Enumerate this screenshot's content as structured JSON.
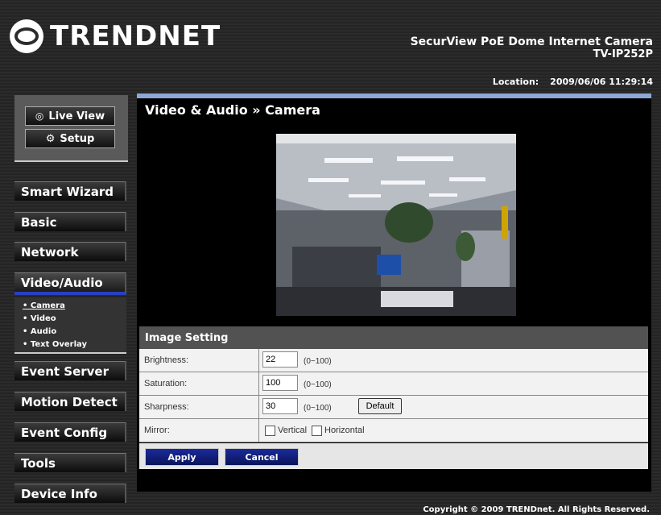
{
  "header": {
    "brand": "TRENDNET",
    "product_name": "SecurView PoE Dome Internet Camera",
    "model": "TV-IP252P",
    "location_label": "Location:",
    "datetime": "2009/06/06 11:29:14"
  },
  "quick_buttons": {
    "live_view": "Live View",
    "setup": "Setup"
  },
  "menu": {
    "smart_wizard": "Smart Wizard",
    "basic": "Basic",
    "network": "Network",
    "video_audio": "Video/Audio",
    "event_server": "Event Server",
    "motion_detect": "Motion Detect",
    "event_config": "Event Config",
    "tools": "Tools",
    "device_info": "Device Info"
  },
  "submenu": {
    "camera": "• Camera",
    "video": "• Video",
    "audio": "• Audio",
    "text_overlay": "• Text Overlay"
  },
  "page_title": "Video & Audio » Camera",
  "image_setting": {
    "section_title": "Image Setting",
    "brightness_label": "Brightness:",
    "brightness_value": "22",
    "brightness_range": "(0~100)",
    "saturation_label": "Saturation:",
    "saturation_value": "100",
    "saturation_range": "(0~100)",
    "sharpness_label": "Sharpness:",
    "sharpness_value": "30",
    "sharpness_range": "(0~100)",
    "default_label": "Default",
    "mirror_label": "Mirror:",
    "vertical_label": "Vertical",
    "horizontal_label": "Horizontal"
  },
  "actions": {
    "apply": "Apply",
    "cancel": "Cancel"
  },
  "footer": {
    "copyright": "Copyright © 2009 TRENDnet. All Rights Reserved."
  }
}
